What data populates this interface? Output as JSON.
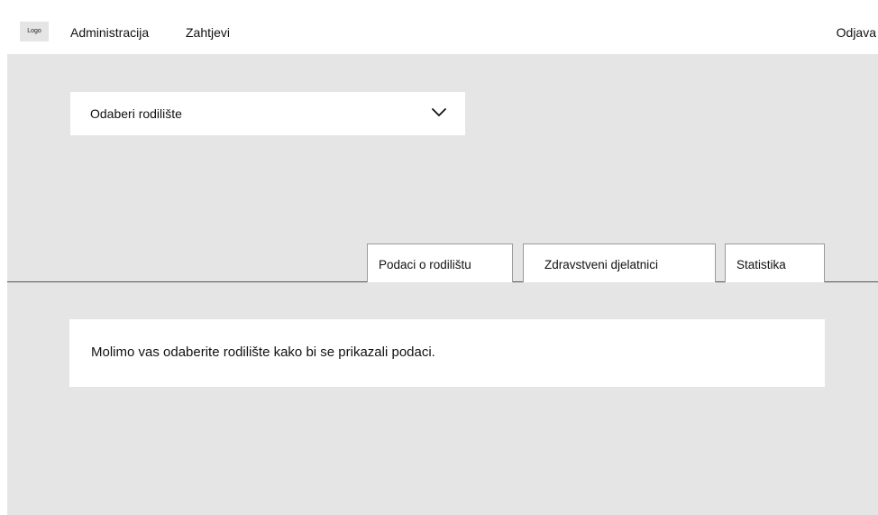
{
  "header": {
    "logo_text": "Logo",
    "nav": {
      "administration": "Administracija",
      "requests": "Zahtjevi"
    },
    "logout": "Odjava"
  },
  "maternity_select": {
    "placeholder": "Odaberi rodilište",
    "icon": "chevron-down-icon"
  },
  "tabs": [
    {
      "label": "Podaci o rodilištu"
    },
    {
      "label": "Zdravstveni djelatnici"
    },
    {
      "label": "Statistika"
    }
  ],
  "message": "Molimo vas odaberite rodilište kako bi se prikazali podaci.",
  "colors": {
    "page_background": "#e5e5e5",
    "surface": "#ffffff",
    "tab_border": "#9a9a9a",
    "divider": "#555555"
  }
}
